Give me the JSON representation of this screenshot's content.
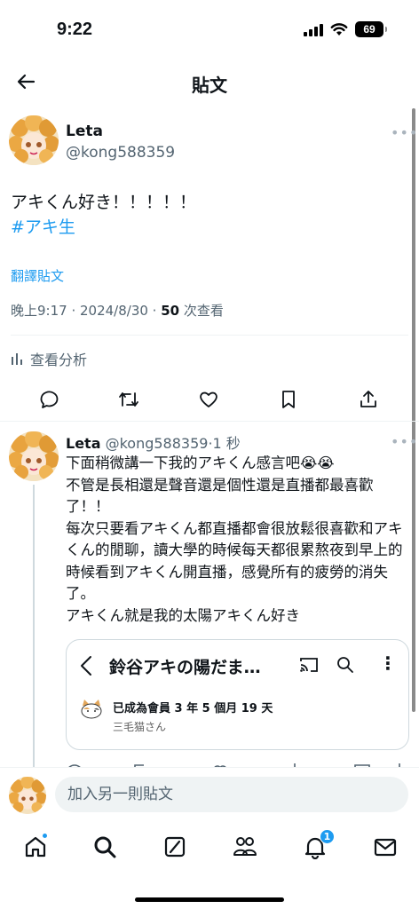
{
  "status_bar": {
    "time": "9:22",
    "battery": "69"
  },
  "header": {
    "title": "貼文"
  },
  "post": {
    "author_name": "Leta",
    "author_handle": "@kong588359",
    "text_line1": "アキくん好き！！！！！",
    "hashtag": "#アキ生",
    "translate": "翻譯貼文",
    "time": "晚上9:17 · 2024/8/30 · ",
    "views_count": "50",
    "views_label": " 次查看",
    "analytics": "查看分析"
  },
  "reply": {
    "author_name": "Leta",
    "author_handle": "@kong588359",
    "age": "·1 秒",
    "lines": [
      "下面稍微講一下我的アキくん感言吧😭😭",
      "不管是長相還是聲音還是個性還是直播都最喜歡了！！",
      "每次只要看アキくん都直播都會很放鬆很喜歡和アキくん的閒聊，讀大學的時候每天都很累熬夜到早上的時候看到アキくん開直播，感覺所有的疲勞的消失了。",
      "アキくん就是我的太陽アキくん好き"
    ],
    "card": {
      "title": "鈴谷アキの陽だま…",
      "member_title": "已成為會員 3 年 5 個月 19 天",
      "member_name": "三毛猫さん"
    }
  },
  "reply_bar": {
    "placeholder": "加入另一則貼文"
  },
  "nav": {
    "notification_count": "1"
  },
  "colors": {
    "accent": "#1d9bf0",
    "text": "#0f1419",
    "muted": "#536471"
  },
  "icons": [
    "back-arrow-icon",
    "more-icon",
    "analytics-icon",
    "reply-icon",
    "retweet-icon",
    "like-icon",
    "bookmark-icon",
    "share-icon",
    "home-icon",
    "search-icon",
    "grok-icon",
    "communities-icon",
    "notifications-icon",
    "messages-icon"
  ]
}
